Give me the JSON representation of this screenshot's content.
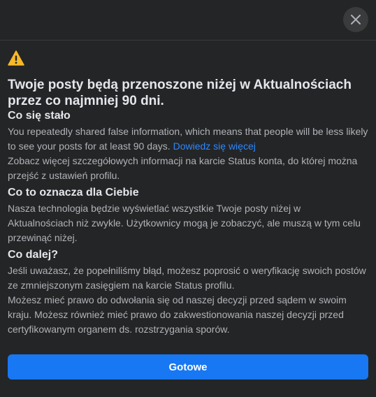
{
  "dialog": {
    "close_icon": "close-icon",
    "warning_icon": "warning-triangle-icon",
    "title": "Twoje posty będą przenoszone niżej w Aktualnościach przez co najmniej 90 dni.",
    "sections": [
      {
        "heading": "Co się stało",
        "paragraphs": [
          {
            "text": "You repeatedly shared false information, which means that people will be less likely to see your posts for at least 90 days. ",
            "link": "Dowiedz się więcej"
          },
          {
            "text": "Zobacz więcej szczegółowych informacji na karcie Status konta, do której można przejść z ustawień profilu."
          }
        ]
      },
      {
        "heading": "Co to oznacza dla Ciebie",
        "paragraphs": [
          {
            "text": "Nasza technologia będzie wyświetlać wszystkie Twoje posty niżej w Aktualnościach niż zwykle. Użytkownicy mogą je zobaczyć, ale muszą w tym celu przewinąć niżej."
          }
        ]
      },
      {
        "heading": "Co dalej?",
        "paragraphs": [
          {
            "text": "Jeśli uważasz, że popełniliśmy błąd, możesz poprosić o weryfikację swoich postów ze zmniejszonym zasięgiem na karcie Status profilu."
          },
          {
            "text": "Możesz mieć prawo do odwołania się od naszej decyzji przed sądem w swoim kraju. Możesz również mieć prawo do zakwestionowania naszej decyzji przed certyfikowanym organem ds. rozstrzygania sporów."
          }
        ]
      }
    ],
    "done_label": "Gotowe"
  },
  "colors": {
    "background": "#242526",
    "text_primary": "#e4e6eb",
    "text_secondary": "#b0b3b8",
    "link": "#2d88ff",
    "button": "#1877f2",
    "warning": "#f7b928"
  }
}
